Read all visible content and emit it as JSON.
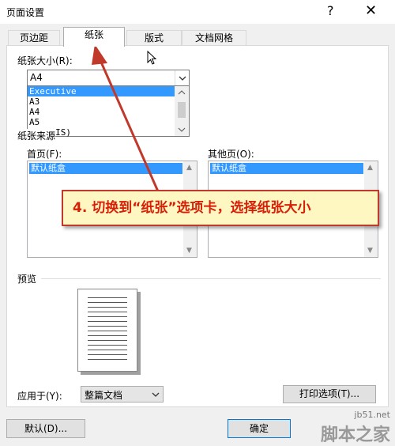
{
  "window": {
    "title": "页面设置",
    "help_glyph": "?",
    "close_glyph": "✕"
  },
  "tabs": [
    {
      "label": "页边距",
      "active": false
    },
    {
      "label": "纸张",
      "active": true
    },
    {
      "label": "版式",
      "active": false
    },
    {
      "label": "文档网格",
      "active": false
    }
  ],
  "paper_size": {
    "label": "纸张大小(R):",
    "selected": "A4",
    "options": [
      "Executive",
      "A3",
      "A4",
      "A5",
      "B4 (JIS)"
    ],
    "highlighted": "Executive"
  },
  "paper_source": {
    "label": "纸张来源",
    "first_page_label": "首页(F):",
    "other_pages_label": "其他页(O):",
    "first_page_value": "默认纸盒",
    "other_pages_value": "默认纸盒"
  },
  "preview": {
    "label": "预览"
  },
  "apply_to": {
    "label": "应用于(Y):",
    "value": "整篇文档"
  },
  "buttons": {
    "print_options": "打印选项(T)...",
    "default": "默认(D)...",
    "ok": "确定"
  },
  "annotation": {
    "text": "4. 切换到“纸张”选项卡，选择纸张大小"
  },
  "watermark": {
    "site": "jb51.net",
    "brand": "脚本之家"
  },
  "colors": {
    "callout_border": "#c0392b",
    "callout_text": "#d81e06",
    "callout_bg": "#fff7c2",
    "selection": "#3399ff"
  }
}
